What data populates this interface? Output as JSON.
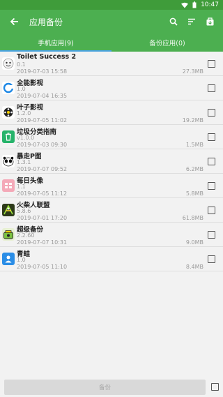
{
  "status_bar": {
    "time": "10:47"
  },
  "app_bar": {
    "title": "应用备份"
  },
  "tabs": [
    {
      "label": "手机应用(9)",
      "active": true
    },
    {
      "label": "备份应用(0)",
      "active": false
    }
  ],
  "apps": [
    {
      "name": "Toilet Success 2",
      "version": "0.1",
      "date": "2019-07-03 15:58",
      "size": "27.3MB",
      "icon": "toilet-success-icon"
    },
    {
      "name": "全能影视",
      "version": "1.0",
      "date": "2019-07-04 16:35",
      "size": "",
      "icon": "quanneng-video-icon"
    },
    {
      "name": "叶子影视",
      "version": "1.2.0",
      "date": "2019-07-05 11:02",
      "size": "19.2MB",
      "icon": "yezi-video-icon"
    },
    {
      "name": "垃圾分类指南",
      "version": "v1.0.0",
      "date": "2019-07-03 09:30",
      "size": "1.5MB",
      "icon": "garbage-guide-icon"
    },
    {
      "name": "暴走P图",
      "version": "1.3.1",
      "date": "2019-07-07 09:52",
      "size": "6.2MB",
      "icon": "baozou-ptu-icon"
    },
    {
      "name": "每日头像",
      "version": "1.1",
      "date": "2019-07-05 11:12",
      "size": "5.8MB",
      "icon": "daily-avatar-icon"
    },
    {
      "name": "火柴人联盟",
      "version": "5.8.6",
      "date": "2019-07-01 17:20",
      "size": "61.8MB",
      "icon": "stickman-league-icon"
    },
    {
      "name": "超级备份",
      "version": "2.2.60",
      "date": "2019-07-07 10:31",
      "size": "9.0MB",
      "icon": "super-backup-icon"
    },
    {
      "name": "青蛙",
      "version": "1.0",
      "date": "2019-07-05 11:10",
      "size": "8.4MB",
      "icon": "frog-icon"
    }
  ],
  "bottom": {
    "backup_label": "备份"
  },
  "colors": {
    "primary": "#4caf50",
    "status_bar": "#3f9c3a",
    "tab_indicator": "#4aa3df"
  }
}
